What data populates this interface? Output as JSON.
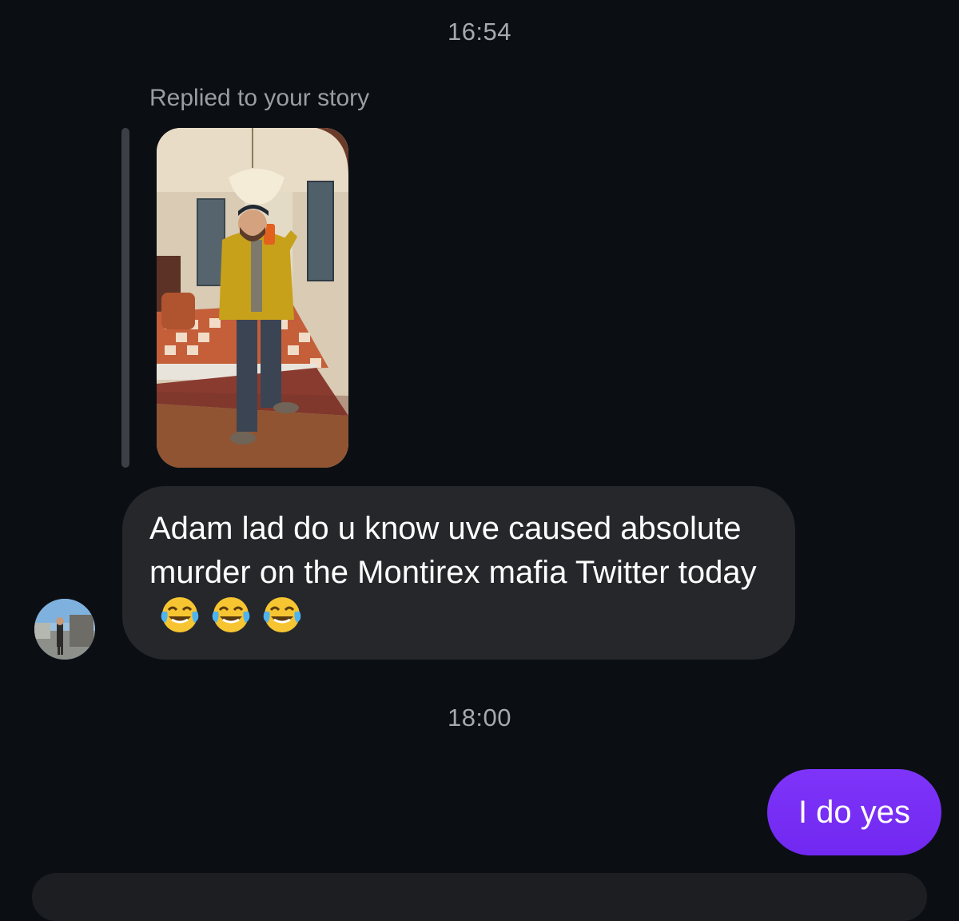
{
  "thread": {
    "timestamp_1": "16:54",
    "story_reply_label": "Replied to your story",
    "incoming_message": {
      "text": "Adam lad do u know uve caused absolute murder on the Montirex mafia Twitter today",
      "emoji": [
        "face-with-tears-of-joy",
        "face-with-tears-of-joy",
        "face-with-tears-of-joy"
      ]
    },
    "timestamp_2": "18:00",
    "outgoing_message": {
      "text": "I do yes"
    }
  },
  "colors": {
    "background": "#0b0f14",
    "incoming_bubble": "#25272b",
    "outgoing_bubble": "#7a2ff6",
    "timestamp_text": "#a7a9ad",
    "reply_bar": "#3c3f45"
  }
}
